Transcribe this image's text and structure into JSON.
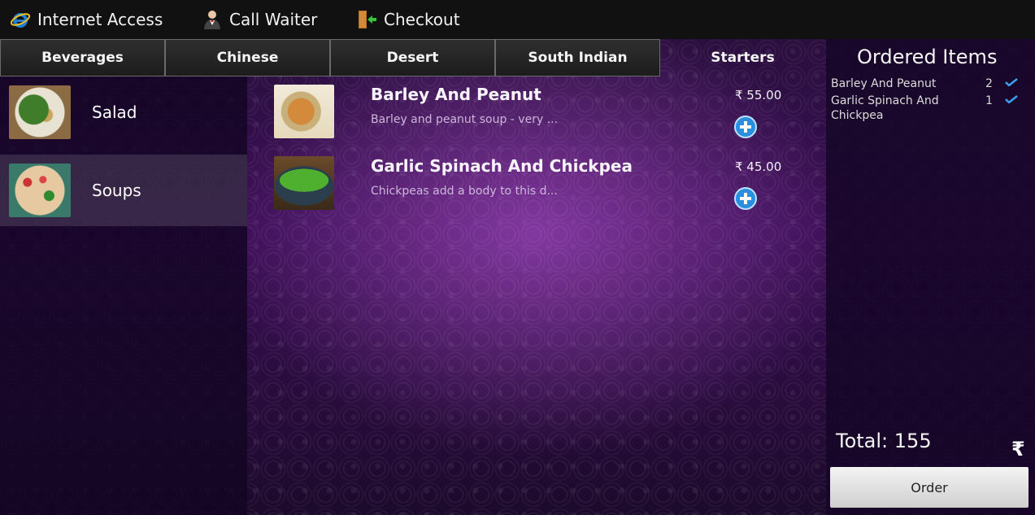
{
  "topbar": {
    "internet_label": "Internet Access",
    "waiter_label": "Call Waiter",
    "checkout_label": "Checkout"
  },
  "tabs": [
    {
      "label": "Beverages"
    },
    {
      "label": "Chinese"
    },
    {
      "label": "Desert"
    },
    {
      "label": "South Indian"
    },
    {
      "label": "Starters",
      "active": true
    }
  ],
  "subcategories": [
    {
      "label": "Salad"
    },
    {
      "label": "Soups",
      "selected": true
    }
  ],
  "dishes": [
    {
      "name": "Barley And Peanut",
      "description": "Barley and peanut soup - very ...",
      "price": "₹ 55.00"
    },
    {
      "name": "Garlic Spinach And Chickpea",
      "description": "Chickpeas add a body to this d...",
      "price": "₹ 45.00"
    }
  ],
  "orders": {
    "title": "Ordered Items",
    "items": [
      {
        "name": "Barley And Peanut",
        "qty": "2"
      },
      {
        "name": "Garlic Spinach And Chickpea",
        "qty": "1"
      }
    ],
    "total_label": "Total:",
    "total_value": "155",
    "currency_symbol": "₹",
    "order_button": "Order"
  },
  "colors": {
    "accent_blue": "#2b8fe0",
    "panel_purple": "#3a0e55"
  },
  "icons": {
    "internet": "internet-explorer-icon",
    "waiter": "waiter-icon",
    "checkout": "exit-door-icon",
    "add": "plus-circle-icon",
    "check": "checkmark-icon",
    "currency": "rupee-icon"
  }
}
